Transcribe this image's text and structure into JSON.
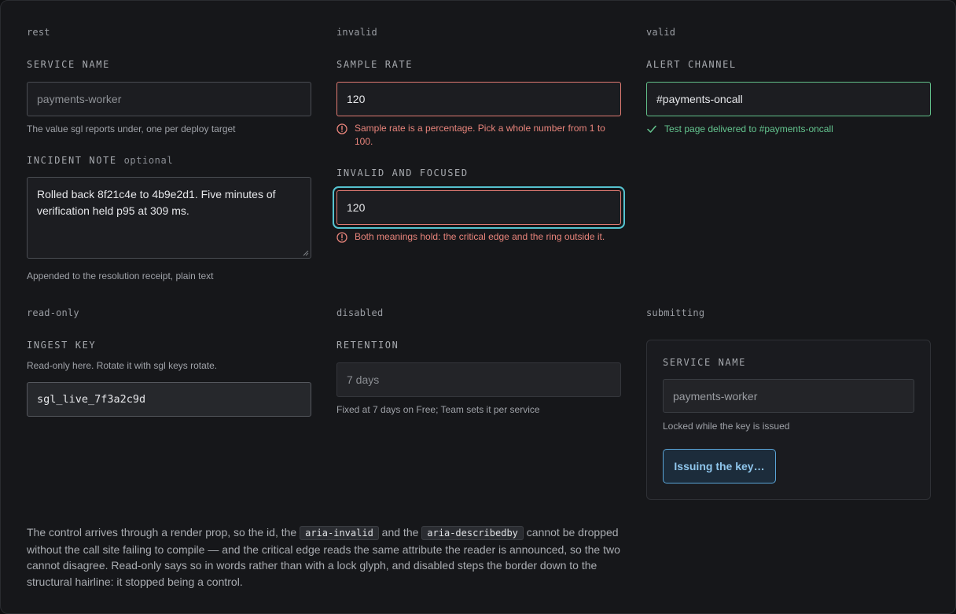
{
  "colors": {
    "error": "#e8847b",
    "success": "#64c58f",
    "focus_ring": "#55c2cf",
    "accent": "#5aa4d6"
  },
  "rest": {
    "state": "rest",
    "service_name": {
      "label": "SERVICE NAME",
      "value": "payments-worker",
      "help": "The value sgl reports under, one per deploy target"
    },
    "incident_note": {
      "label": "INCIDENT NOTE",
      "optional": "optional",
      "value": "Rolled back 8f21c4e to 4b9e2d1. Five minutes of verification held p95 at 309 ms.",
      "help": "Appended to the resolution receipt, plain text"
    }
  },
  "invalid": {
    "state": "invalid",
    "sample_rate": {
      "label": "SAMPLE RATE",
      "value": "120",
      "error": "Sample rate is a percentage. Pick a whole number from 1 to 100.",
      "error_icon": "alert-circle-icon"
    },
    "focused": {
      "label": "INVALID AND FOCUSED",
      "value": "120",
      "error": "Both meanings hold: the critical edge and the ring outside it.",
      "error_icon": "alert-circle-icon"
    }
  },
  "valid": {
    "state": "valid",
    "alert_channel": {
      "label": "ALERT CHANNEL",
      "value": "#payments-oncall",
      "success": "Test page delivered to #payments-oncall",
      "success_icon": "check-icon"
    }
  },
  "readonly": {
    "state": "read-only",
    "ingest_key": {
      "label": "INGEST KEY",
      "note": "Read-only here. Rotate it with sgl keys rotate.",
      "value": "sgl_live_7f3a2c9d"
    }
  },
  "disabled": {
    "state": "disabled",
    "retention": {
      "label": "RETENTION",
      "value": "7 days",
      "help": "Fixed at 7 days on Free; Team sets it per service"
    }
  },
  "submitting": {
    "state": "submitting",
    "service_name": {
      "label": "SERVICE NAME",
      "value": "payments-worker",
      "help": "Locked while the key is issued"
    },
    "button_label": "Issuing the key…"
  },
  "prose": {
    "part1": "The control arrives through a render prop, so the id, the ",
    "code1": "aria-invalid",
    "part2": " and the ",
    "code2": "aria-describedby",
    "part3": " cannot be dropped without the call site failing to compile — and the critical edge reads the same attribute the reader is announced, so the two cannot disagree. Read-only says so in words rather than with a lock glyph, and disabled steps the border down to the structural hairline: it stopped being a control."
  }
}
